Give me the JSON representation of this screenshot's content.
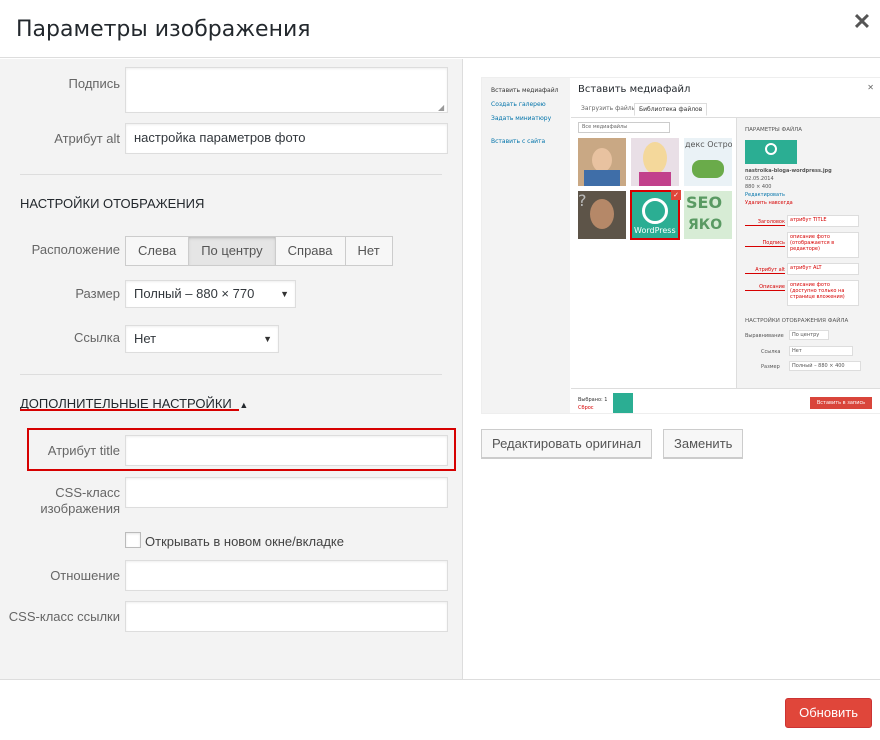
{
  "dialog": {
    "title": "Параметры изображения",
    "update_label": "Обновить"
  },
  "fields": {
    "caption_label": "Подпись",
    "caption_value": "",
    "alt_label": "Атрибут alt",
    "alt_value": "настройка параметров фото"
  },
  "display": {
    "heading": "НАСТРОЙКИ ОТОБРАЖЕНИЯ",
    "align_label": "Расположение",
    "align_options": [
      "Слева",
      "По центру",
      "Справа",
      "Нет"
    ],
    "align_selected": "По центру",
    "size_label": "Размер",
    "size_value": "Полный – 880 × 770",
    "link_label": "Ссылка",
    "link_value": "Нет"
  },
  "advanced": {
    "heading": "ДОПОЛНИТЕЛЬНЫЕ НАСТРОЙКИ",
    "title_label": "Атрибут title",
    "title_value": "",
    "css_class_label_1": "CSS-класс",
    "css_class_label_2": "изображения",
    "css_class_value": "",
    "new_window_label": "Открывать в новом окне/вкладке",
    "new_window_checked": false,
    "rel_label": "Отношение",
    "rel_value": "",
    "link_css_label": "CSS-класс ссылки",
    "link_css_value": ""
  },
  "preview": {
    "edit_original_label": "Редактировать оригинал",
    "replace_label": "Заменить",
    "thumbnail": {
      "sidebar": [
        "Вставить медиафайл",
        "Создать галерею",
        "Задать миниатюру",
        "Вставить с сайта"
      ],
      "title": "Вставить медиафайл",
      "tabs": [
        "Загрузить файлы",
        "Библиотека файлов"
      ],
      "filter": "Все медиафайлы",
      "panel_heading": "ПАРАМЕТРЫ ФАЙЛА",
      "file_name": "nastroika-bloga-wordpress.jpg",
      "file_date": "02.05.2014",
      "file_dims": "880 × 400",
      "edit_link": "Редактировать",
      "delete_link": "Удалить навсегда",
      "field_labels": [
        "Заголовок",
        "Подпись",
        "Атрибут alt",
        "Описание"
      ],
      "field_values": [
        "атрибут TITLE",
        "описание фото (отображается в редакторе)",
        "атрибут ALT",
        "описание фото (доступно только на странице вложения)"
      ],
      "display_heading": "НАСТРОЙКИ ОТОБРАЖЕНИЯ ФАЙЛА",
      "display_labels": [
        "Выравнивание",
        "Ссылка",
        "Размер"
      ],
      "display_values": [
        "По центру",
        "Нет",
        "Полный – 880 × 400"
      ],
      "selected_text": "Выбрано: 1",
      "clear_text": "Сброс",
      "insert_button": "Вставить в запись",
      "tile_texts": [
        "декс Остро",
        "WordPress",
        "SEO",
        "ЯКО"
      ]
    }
  },
  "colors": {
    "accent_red": "#e0463a",
    "annotation_red": "#d60000",
    "wp_teal": "#2bae93",
    "link_blue": "#0073aa"
  }
}
